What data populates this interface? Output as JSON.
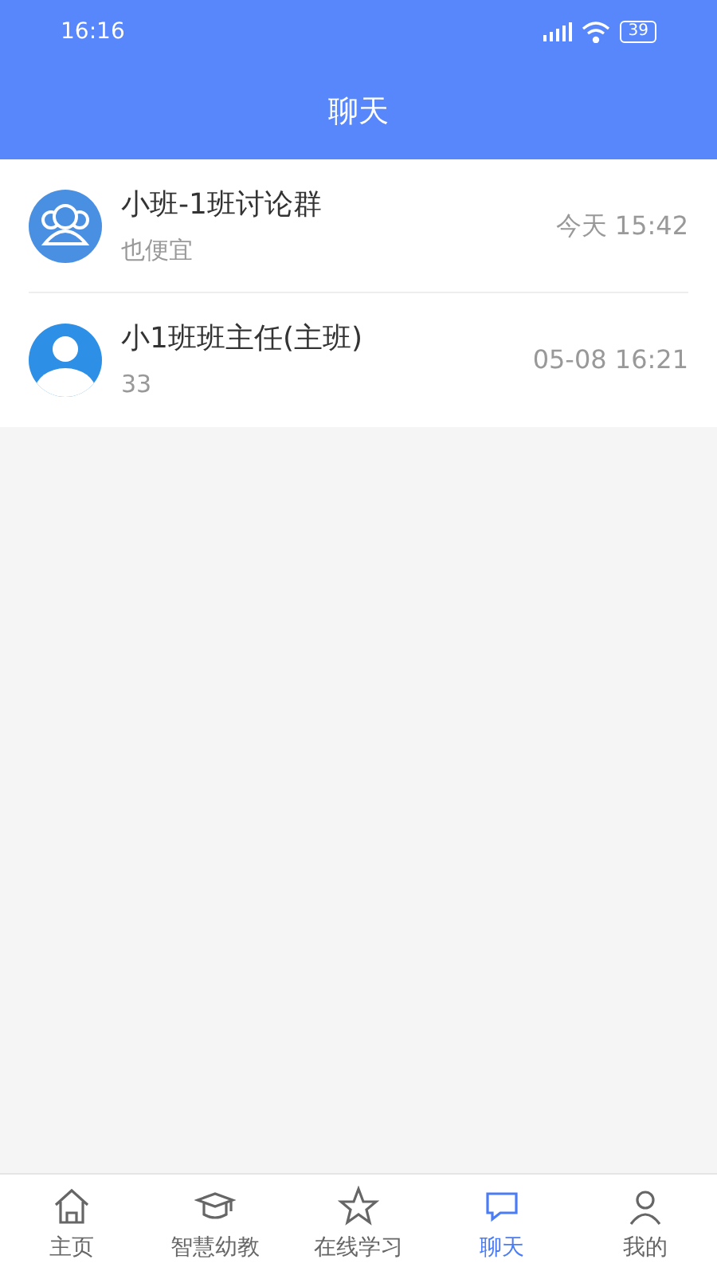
{
  "status_bar": {
    "time": "16:16",
    "battery": "39"
  },
  "header": {
    "title": "聊天"
  },
  "chats": [
    {
      "kind": "group",
      "name": "小班-1班讨论群",
      "preview": "也便宜",
      "time": "今天 15:42"
    },
    {
      "kind": "person",
      "name": "小1班班主任(主班)",
      "preview": "33",
      "time": "05-08 16:21"
    }
  ],
  "tab_bar": [
    {
      "kind": "home",
      "label": "主页",
      "selected": false
    },
    {
      "kind": "cap",
      "label": "智慧幼教",
      "selected": false
    },
    {
      "kind": "star",
      "label": "在线学习",
      "selected": false
    },
    {
      "kind": "chat",
      "label": "聊天",
      "selected": true
    },
    {
      "kind": "user",
      "label": "我的",
      "selected": false
    }
  ]
}
